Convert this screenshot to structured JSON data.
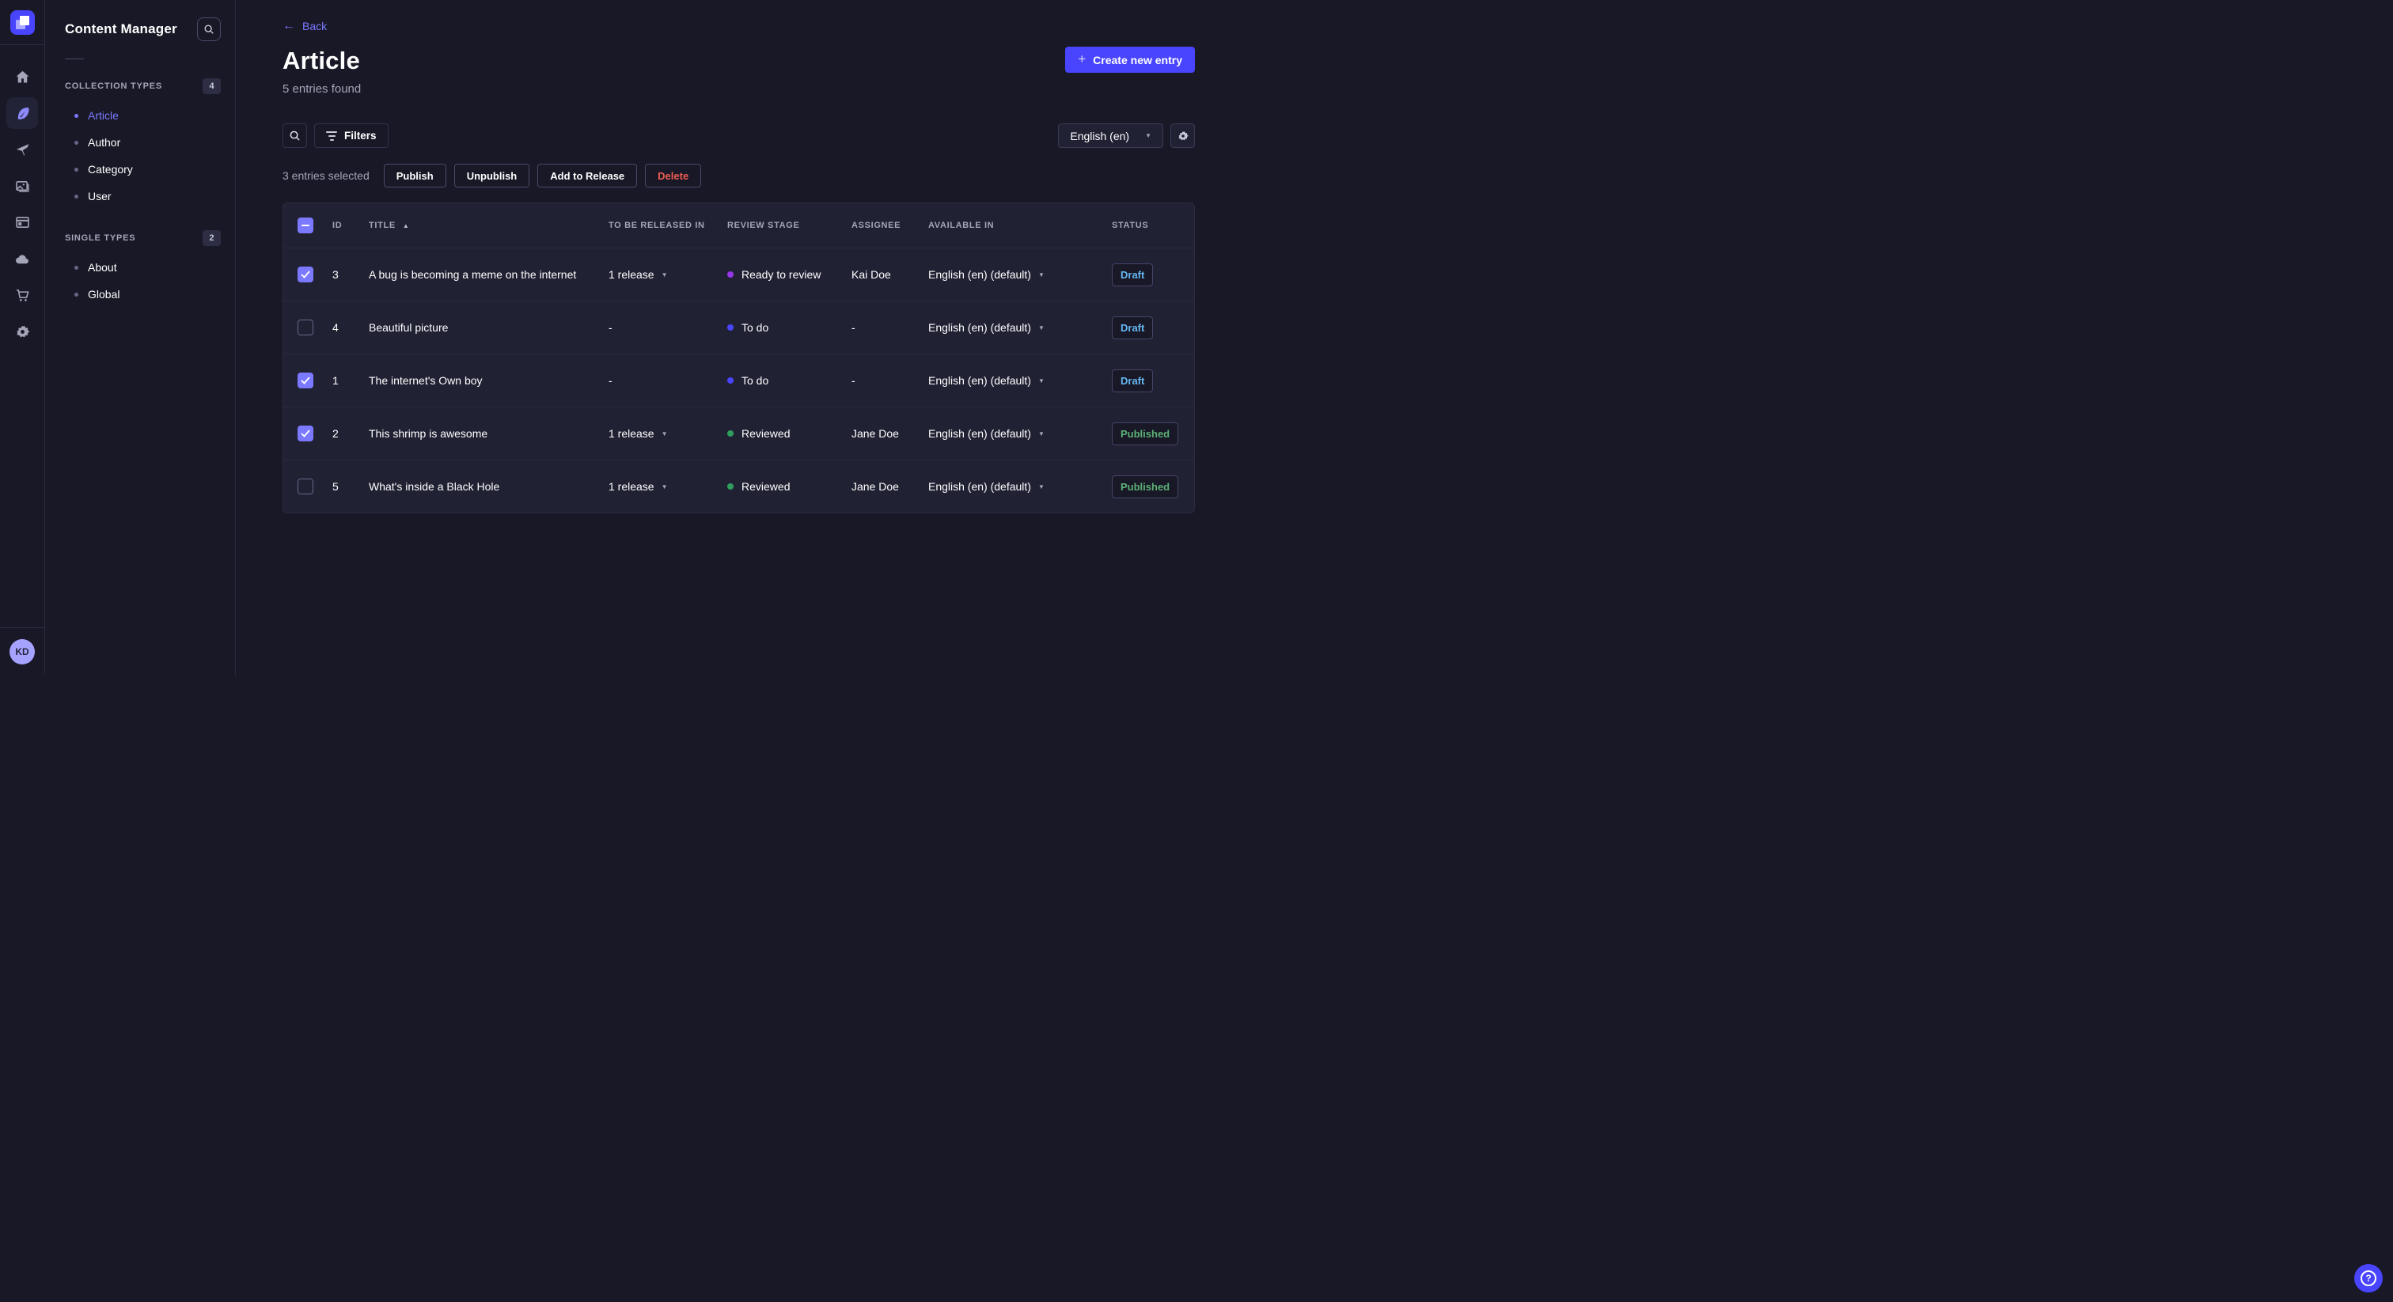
{
  "nav": {
    "user_initials": "KD",
    "icons": [
      "strapi-logo",
      "home",
      "content-manager",
      "releases",
      "media-library",
      "content-type-builder",
      "cloud",
      "marketplace",
      "settings"
    ]
  },
  "sidebar": {
    "title": "Content Manager",
    "sections": [
      {
        "label": "COLLECTION TYPES",
        "count": "4",
        "items": [
          {
            "label": "Article"
          },
          {
            "label": "Author"
          },
          {
            "label": "Category"
          },
          {
            "label": "User"
          }
        ]
      },
      {
        "label": "SINGLE TYPES",
        "count": "2",
        "items": [
          {
            "label": "About"
          },
          {
            "label": "Global"
          }
        ]
      }
    ]
  },
  "header": {
    "back_label": "Back",
    "title": "Article",
    "subtitle": "5 entries found",
    "create_button": "Create new entry"
  },
  "toolbar": {
    "filters_label": "Filters",
    "locale_select": "English (en)"
  },
  "selection": {
    "text": "3 entries selected",
    "publish": "Publish",
    "unpublish": "Unpublish",
    "add_to_release": "Add to Release",
    "delete": "Delete"
  },
  "table": {
    "headers": {
      "id": "ID",
      "title": "TITLE",
      "released": "TO BE RELEASED IN",
      "stage": "REVIEW STAGE",
      "assignee": "ASSIGNEE",
      "available": "AVAILABLE IN",
      "status": "STATUS"
    },
    "rows": [
      {
        "checked": true,
        "id": "3",
        "title": "A bug is becoming a meme on the internet",
        "release": "1 release",
        "release_caret": "▼",
        "stage": "Ready to review",
        "stage_color": "#9736e8",
        "assignee": "Kai Doe",
        "locale": "English (en) (default)",
        "locale_caret": "▼",
        "status": "Draft"
      },
      {
        "checked": false,
        "id": "4",
        "title": "Beautiful picture",
        "release": "-",
        "stage": "To do",
        "stage_color": "#4945ff",
        "assignee": "-",
        "locale": "English (en) (default)",
        "locale_caret": "▼",
        "status": "Draft"
      },
      {
        "checked": true,
        "id": "1",
        "title": "The internet's Own boy",
        "release": "-",
        "stage": "To do",
        "stage_color": "#4945ff",
        "assignee": "-",
        "locale": "English (en) (default)",
        "locale_caret": "▼",
        "status": "Draft"
      },
      {
        "checked": true,
        "id": "2",
        "title": "This shrimp is awesome",
        "release": "1 release",
        "release_caret": "▼",
        "stage": "Reviewed",
        "stage_color": "#2f9e5e",
        "assignee": "Jane Doe",
        "locale": "English (en) (default)",
        "locale_caret": "▼",
        "status": "Published"
      },
      {
        "checked": false,
        "id": "5",
        "title": "What's inside a Black Hole",
        "release": "1 release",
        "release_caret": "▼",
        "stage": "Reviewed",
        "stage_color": "#2f9e5e",
        "assignee": "Jane Doe",
        "locale": "English (en) (default)",
        "locale_caret": "▼",
        "status": "Published"
      }
    ]
  },
  "colors": {
    "primary": "#4945ff",
    "link": "#7b79ff",
    "surface": "#212134",
    "background": "#181826",
    "draft_text": "#66b7f1",
    "published_text": "#5cb176",
    "stage_ready_to_review": "#9736e8",
    "stage_todo": "#4945ff",
    "stage_reviewed": "#2f9e5e"
  }
}
